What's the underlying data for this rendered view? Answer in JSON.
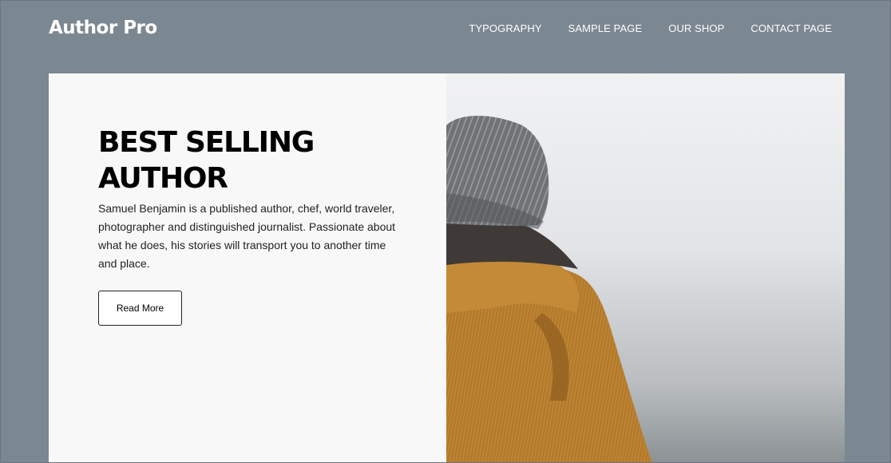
{
  "header": {
    "site_title": "Author Pro",
    "nav": [
      {
        "label": "TYPOGRAPHY"
      },
      {
        "label": "SAMPLE PAGE"
      },
      {
        "label": "OUR SHOP"
      },
      {
        "label": "CONTACT PAGE"
      }
    ]
  },
  "hero": {
    "title": "BEST SELLING AUTHOR",
    "description": "Samuel Benjamin is a published author, chef, world traveler, photographer and distinguished journalist. Passionate about what he does, his stories will transport you to another time and place.",
    "button_label": "Read More"
  },
  "colors": {
    "background": "#7b8791",
    "panel": "#f8f8f8",
    "text": "#000000",
    "jacket": "#b9812c"
  }
}
